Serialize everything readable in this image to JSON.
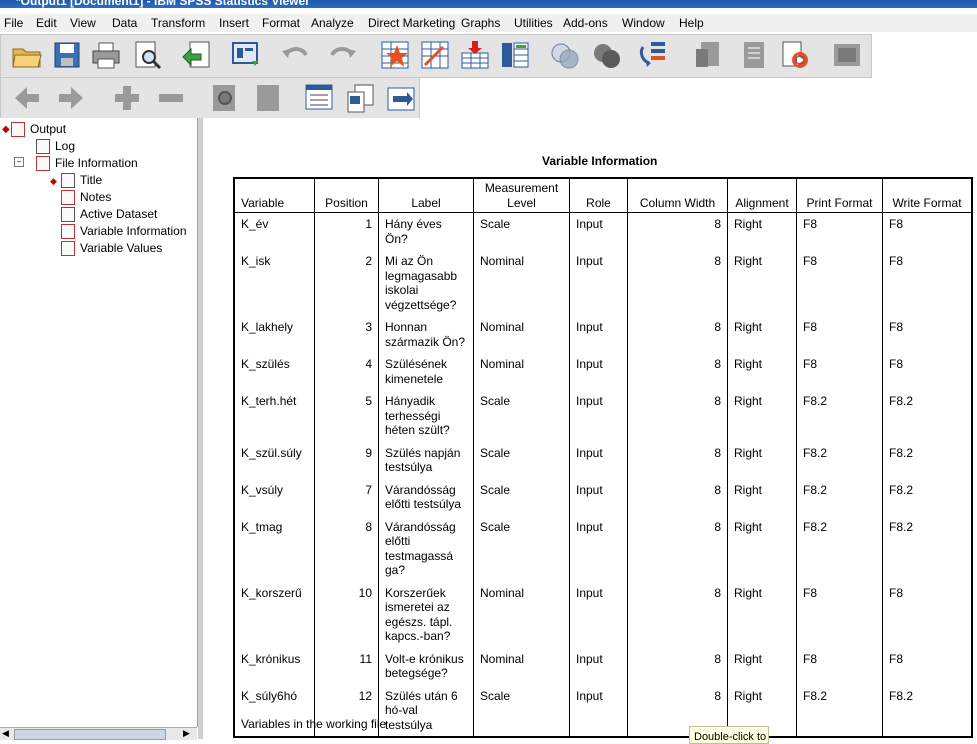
{
  "window": {
    "title": "*Output1 [Document1] - IBM SPSS Statistics Viewer"
  },
  "menu": [
    "File",
    "Edit",
    "View",
    "Data",
    "Transform",
    "Insert",
    "Format",
    "Analyze",
    "Direct Marketing",
    "Graphs",
    "Utilities",
    "Add-ons",
    "Window",
    "Help"
  ],
  "toolbar1": [
    "open-icon",
    "save-icon",
    "print-icon",
    "print-preview-icon",
    "export-icon",
    "recall-dialog-icon",
    "undo-icon",
    "redo-icon",
    "goto-case-icon",
    "goto-variable-icon",
    "insert-cases-icon",
    "variables-icon",
    "select-cases-icon",
    "value-labels-icon",
    "use-sets-icon",
    "show-all-icon",
    "designate-window-icon",
    "insert-output-icon",
    "insert-text-icon",
    "run-script-icon",
    "hide-icon"
  ],
  "toolbar2": [
    "promote-icon",
    "demote-icon",
    "expand-icon",
    "collapse-icon",
    "show-icon",
    "hide-icon",
    "insert-heading-icon",
    "insert-title-icon",
    "insert-text-box-icon"
  ],
  "tree": {
    "root": "Output",
    "log": "Log",
    "file_info": "File Information",
    "items": [
      "Title",
      "Notes",
      "Active Dataset",
      "Variable Information",
      "Variable Values"
    ]
  },
  "table": {
    "title": "Variable Information",
    "headers": [
      "Variable",
      "Position",
      "Label",
      "Measurement Level",
      "Role",
      "Column Width",
      "Alignment",
      "Print Format",
      "Write Format"
    ],
    "rows": [
      [
        "K_év",
        "1",
        "Hány éves Ön?",
        "Scale",
        "Input",
        "8",
        "Right",
        "F8",
        "F8"
      ],
      [
        "K_isk",
        "2",
        "Mi az Ön legmagasabb iskolai végzettsége?",
        "Nominal",
        "Input",
        "8",
        "Right",
        "F8",
        "F8"
      ],
      [
        "K_lakhely",
        "3",
        "Honnan származik Ön?",
        "Nominal",
        "Input",
        "8",
        "Right",
        "F8",
        "F8"
      ],
      [
        "K_szülés",
        "4",
        "Szülésének kimenetele",
        "Nominal",
        "Input",
        "8",
        "Right",
        "F8",
        "F8"
      ],
      [
        "K_terh.hét",
        "5",
        "Hányadik terhességi héten szült?",
        "Scale",
        "Input",
        "8",
        "Right",
        "F8.2",
        "F8.2"
      ],
      [
        "K_szül.súly",
        "9",
        "Szülés napján testsúlya",
        "Scale",
        "Input",
        "8",
        "Right",
        "F8.2",
        "F8.2"
      ],
      [
        "K_vsúly",
        "7",
        "Várandósság előtti testsúlya",
        "Scale",
        "Input",
        "8",
        "Right",
        "F8.2",
        "F8.2"
      ],
      [
        "K_tmag",
        "8",
        "Várandósság előtti testmagassá ga?",
        "Scale",
        "Input",
        "8",
        "Right",
        "F8.2",
        "F8.2"
      ],
      [
        "K_korszerű",
        "10",
        "Korszerűek ismeretei az egészs. tápl. kapcs.-ban?",
        "Nominal",
        "Input",
        "8",
        "Right",
        "F8",
        "F8"
      ],
      [
        "K_krónikus",
        "11",
        "Volt-e krónikus betegsége?",
        "Nominal",
        "Input",
        "8",
        "Right",
        "F8",
        "F8"
      ],
      [
        "K_súly6hó",
        "12",
        "Szülés után 6 hó-val testsúlya",
        "Scale",
        "Input",
        "8",
        "Right",
        "F8.2",
        "F8.2"
      ]
    ],
    "footnote": "Variables in the working file"
  },
  "tooltip": "Double-click to"
}
